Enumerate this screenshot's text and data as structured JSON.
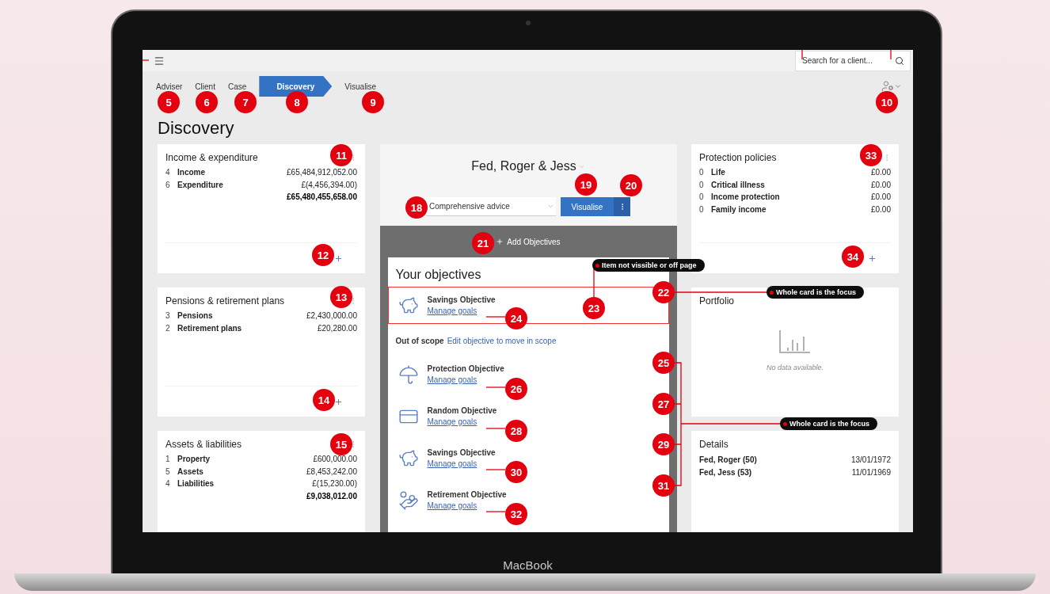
{
  "device": {
    "label": "MacBook"
  },
  "topbar": {
    "search": {
      "placeholder": "Search for a client..."
    }
  },
  "steps": [
    {
      "label": "Adviser",
      "selected": false
    },
    {
      "label": "Client",
      "selected": false
    },
    {
      "label": "Case",
      "selected": false
    },
    {
      "label": "Discovery",
      "selected": true
    },
    {
      "label": "Visualise",
      "selected": false
    }
  ],
  "page_title": "Discovery",
  "left_cards": [
    {
      "title": "Income & expenditure",
      "rows": [
        {
          "count": "4",
          "label": "Income",
          "value": "£65,484,912,052.00"
        },
        {
          "count": "6",
          "label": "Expenditure",
          "value": "£(4,456,394.00)"
        }
      ],
      "total": "£65,480,455,658.00",
      "has_add": true
    },
    {
      "title": "Pensions & retirement plans",
      "rows": [
        {
          "count": "3",
          "label": "Pensions",
          "value": "£2,430,000.00"
        },
        {
          "count": "2",
          "label": "Retirement plans",
          "value": "£20,280.00"
        }
      ],
      "has_add": true
    },
    {
      "title": "Assets & liabilities",
      "rows": [
        {
          "count": "1",
          "label": "Property",
          "value": "£600,000.00"
        },
        {
          "count": "5",
          "label": "Assets",
          "value": "£8,453,242.00"
        },
        {
          "count": "4",
          "label": "Liabilities",
          "value": "£(15,230.00)"
        }
      ],
      "total": "£9,038,012.00",
      "has_add": false
    }
  ],
  "client": {
    "name": "Fed, Roger & Jess",
    "advice": "Comprehensive advice",
    "visualise": "Visualise"
  },
  "objectives": {
    "add": "Add Objectives",
    "heading": "Your objectives",
    "in_scope": [
      {
        "kind": "savings",
        "title": "Savings Objective",
        "link": "Manage goals",
        "focused": true
      }
    ],
    "out_of_scope_label": "Out of scope",
    "out_of_scope_link": "Edit objective to move in scope",
    "out_of_scope": [
      {
        "kind": "protection",
        "title": "Protection Objective",
        "link": "Manage goals"
      },
      {
        "kind": "card",
        "title": "Random Objective",
        "link": "Manage goals"
      },
      {
        "kind": "savings",
        "title": "Savings Objective",
        "link": "Manage goals"
      },
      {
        "kind": "retirement",
        "title": "Retirement Objective",
        "link": "Manage goals"
      }
    ]
  },
  "protection": {
    "title": "Protection policies",
    "rows": [
      {
        "count": "0",
        "label": "Life",
        "value": "£0.00"
      },
      {
        "count": "0",
        "label": "Critical illness",
        "value": "£0.00"
      },
      {
        "count": "0",
        "label": "Income protection",
        "value": "£0.00"
      },
      {
        "count": "0",
        "label": "Family income",
        "value": "£0.00"
      }
    ],
    "has_add": true
  },
  "portfolio": {
    "title": "Portfolio",
    "empty": "No data available."
  },
  "details": {
    "title": "Details",
    "rows": [
      {
        "name": "Fed, Roger (50)",
        "date": "13/01/1972"
      },
      {
        "name": "Fed, Jess (53)",
        "date": "11/01/1969"
      }
    ]
  },
  "annotations": {
    "markers": [
      "5",
      "6",
      "7",
      "8",
      "9",
      "10",
      "11",
      "12",
      "13",
      "14",
      "15",
      "18",
      "19",
      "20",
      "21",
      "22",
      "23",
      "24",
      "25",
      "26",
      "27",
      "28",
      "29",
      "30",
      "31",
      "32",
      "33",
      "34"
    ],
    "callouts": [
      "Item not vissible or off page",
      "Whole card is the focus",
      "Whole card is the focus"
    ]
  }
}
